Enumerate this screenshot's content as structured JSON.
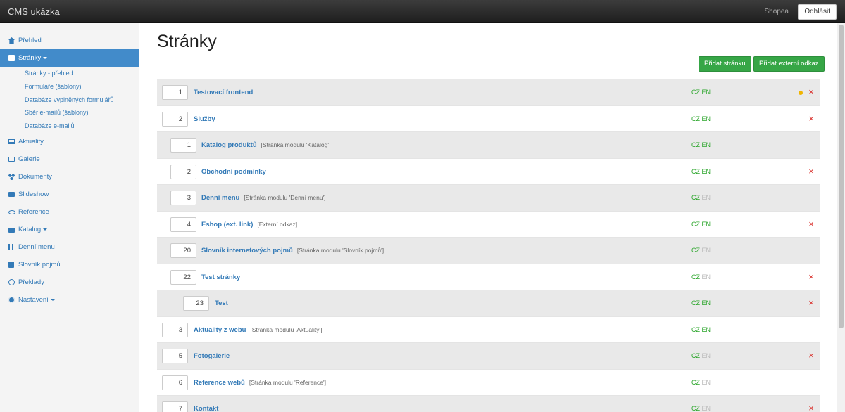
{
  "app": {
    "brand": "CMS ukázka",
    "user": "Shopea",
    "logout_label": "Odhlásit"
  },
  "sidebar": {
    "items": [
      {
        "label": "Přehled",
        "icon": "home-icon"
      },
      {
        "label": "Stránky",
        "icon": "page-icon",
        "active": true,
        "dropdown": true,
        "children": [
          "Stránky - přehled",
          "Formuláře (šablony)",
          "Databáze vyplněných formulářů",
          "Sběr e-mailů (šablony)",
          "Databáze e-mailů"
        ]
      },
      {
        "label": "Aktuality",
        "icon": "laptop-icon"
      },
      {
        "label": "Galerie",
        "icon": "images-icon"
      },
      {
        "label": "Dokumenty",
        "icon": "share-nodes-icon"
      },
      {
        "label": "Slideshow",
        "icon": "film-icon"
      },
      {
        "label": "Reference",
        "icon": "eye-icon"
      },
      {
        "label": "Katalog",
        "icon": "shopping-bag-icon",
        "dropdown": true
      },
      {
        "label": "Denní menu",
        "icon": "cutlery-icon"
      },
      {
        "label": "Slovník pojmů",
        "icon": "book-icon"
      },
      {
        "label": "Překlady",
        "icon": "globe-icon"
      },
      {
        "label": "Nastavení",
        "icon": "gear-icon",
        "dropdown": true
      }
    ]
  },
  "main": {
    "title": "Stránky",
    "add_page_label": "Přidat stránku",
    "add_external_label": "Přidat externí odkaz",
    "lang_cz": "CZ",
    "lang_en": "EN",
    "pages": [
      {
        "order": "1",
        "name": "Testovací frontend",
        "note": "",
        "level": 0,
        "en": true,
        "status_dot": true,
        "deletable": true
      },
      {
        "order": "2",
        "name": "Služby",
        "note": "",
        "level": 0,
        "en": true,
        "status_dot": false,
        "deletable": true
      },
      {
        "order": "1",
        "name": "Katalog produktů",
        "note": "[Stránka modulu 'Katalog']",
        "level": 1,
        "en": true,
        "status_dot": false,
        "deletable": false
      },
      {
        "order": "2",
        "name": "Obchodní podmínky",
        "note": "",
        "level": 1,
        "en": true,
        "status_dot": false,
        "deletable": true
      },
      {
        "order": "3",
        "name": "Denní menu",
        "note": "[Stránka modulu 'Denní menu']",
        "level": 1,
        "en": false,
        "status_dot": false,
        "deletable": false
      },
      {
        "order": "4",
        "name": "Eshop (ext. link)",
        "note": "[Externí odkaz]",
        "level": 1,
        "en": true,
        "status_dot": false,
        "deletable": true
      },
      {
        "order": "20",
        "name": "Slovník internetových pojmů",
        "note": "[Stránka modulu 'Slovník pojmů']",
        "level": 1,
        "en": false,
        "status_dot": false,
        "deletable": false
      },
      {
        "order": "22",
        "name": "Test stránky",
        "note": "",
        "level": 1,
        "en": false,
        "status_dot": false,
        "deletable": true
      },
      {
        "order": "23",
        "name": "Test",
        "note": "",
        "level": 2,
        "en": true,
        "status_dot": false,
        "deletable": true
      },
      {
        "order": "3",
        "name": "Aktuality z webu",
        "note": "[Stránka modulu 'Aktuality']",
        "level": 0,
        "en": true,
        "status_dot": false,
        "deletable": false
      },
      {
        "order": "5",
        "name": "Fotogalerie",
        "note": "",
        "level": 0,
        "en": false,
        "status_dot": false,
        "deletable": true
      },
      {
        "order": "6",
        "name": "Reference webů",
        "note": "[Stránka modulu 'Reference']",
        "level": 0,
        "en": false,
        "status_dot": false,
        "deletable": false
      },
      {
        "order": "7",
        "name": "Kontakt",
        "note": "",
        "level": 0,
        "en": false,
        "status_dot": false,
        "deletable": true
      }
    ]
  }
}
